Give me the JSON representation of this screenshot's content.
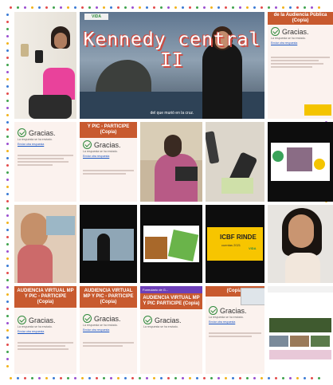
{
  "title_overlay": "Kennedy central II",
  "subtitle_caption": "del que murió en la cruz.",
  "form": {
    "header_cut": "de la Audiencia Pública (Copia)",
    "header_pic": "Y PIC - PARTICIPE (Copia)",
    "header_virtual": "AUDIENCIA VIRTUAL MP Y PIC - PARTICIPE (Copia)",
    "header_virtual_b": "AUDIENCIA VIRTUAL MP Y PIC - PARTICIPE (Copia)",
    "header_virtual_c": "AUDIENCIA VIRTUAL MP Y PIC PARTICIPE (Copia)",
    "header_cut2": "(Copia)",
    "thanks": "Gracias.",
    "response_saved": "La respuesta se ha enviado.",
    "other_link": "Enviar otra respuesta"
  },
  "logo_text": "VIDA",
  "slide_title": "ICBF RINDE",
  "slide_sub": "cuentas 2021",
  "app_bar_title": "Formulario de G..."
}
